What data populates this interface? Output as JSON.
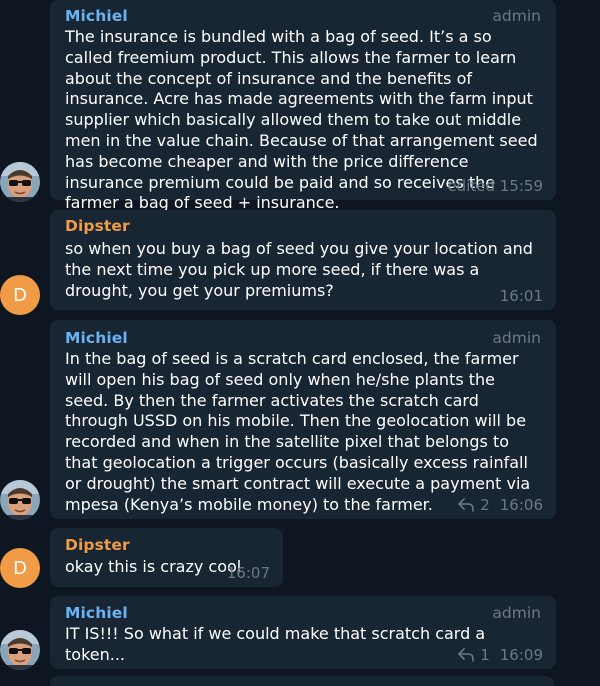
{
  "colors": {
    "background": "#0e1621",
    "bubble": "#182533",
    "michiel_name": "#6ab3f3",
    "dipster_name": "#f09b45",
    "muted": "#6c7883",
    "avatar_letter_bg": "#f09b45"
  },
  "messages": [
    {
      "sender": "Michiel",
      "role": "admin",
      "text": "The insurance is bundled with a bag of seed. It’s a so called freemium product. This allows the farmer to learn about the concept of insurance and the benefits of insurance. Acre has made agreements with the farm input supplier which basically allowed them to take out middle men in the value chain. Because of that arrangement seed has become cheaper and with the price difference insurance premium could be paid and so receives the farmer a bag of seed + insurance.",
      "time": "edited 15:59",
      "avatar_icon": "user-photo-icon"
    },
    {
      "sender": "Dipster",
      "text": "so when you buy a bag of seed you give your location and the next time you pick up more seed, if there was a drought, you get your premiums?",
      "time": "16:01",
      "avatar_letter": "D"
    },
    {
      "sender": "Michiel",
      "role": "admin",
      "text": "In the bag of seed is a scratch card enclosed, the farmer will open his bag of seed only when he/she plants the seed. By then the farmer activates the scratch card through USSD on his mobile. Then the geolocation will be recorded and when in the satellite pixel that belongs to that geolocation a trigger occurs (basically excess rainfall or drought) the smart contract will execute a payment via mpesa (Kenya’s mobile money) to the farmer.",
      "replies": "2",
      "time": "16:06",
      "avatar_icon": "user-photo-icon"
    },
    {
      "sender": "Dipster",
      "text": "okay this is crazy cool",
      "time": "16:07",
      "avatar_letter": "D"
    },
    {
      "sender": "Michiel",
      "role": "admin",
      "text": "IT IS!!! So what if we could make that scratch card a token...",
      "replies": "1",
      "time": "16:09",
      "avatar_icon": "user-photo-icon"
    }
  ]
}
